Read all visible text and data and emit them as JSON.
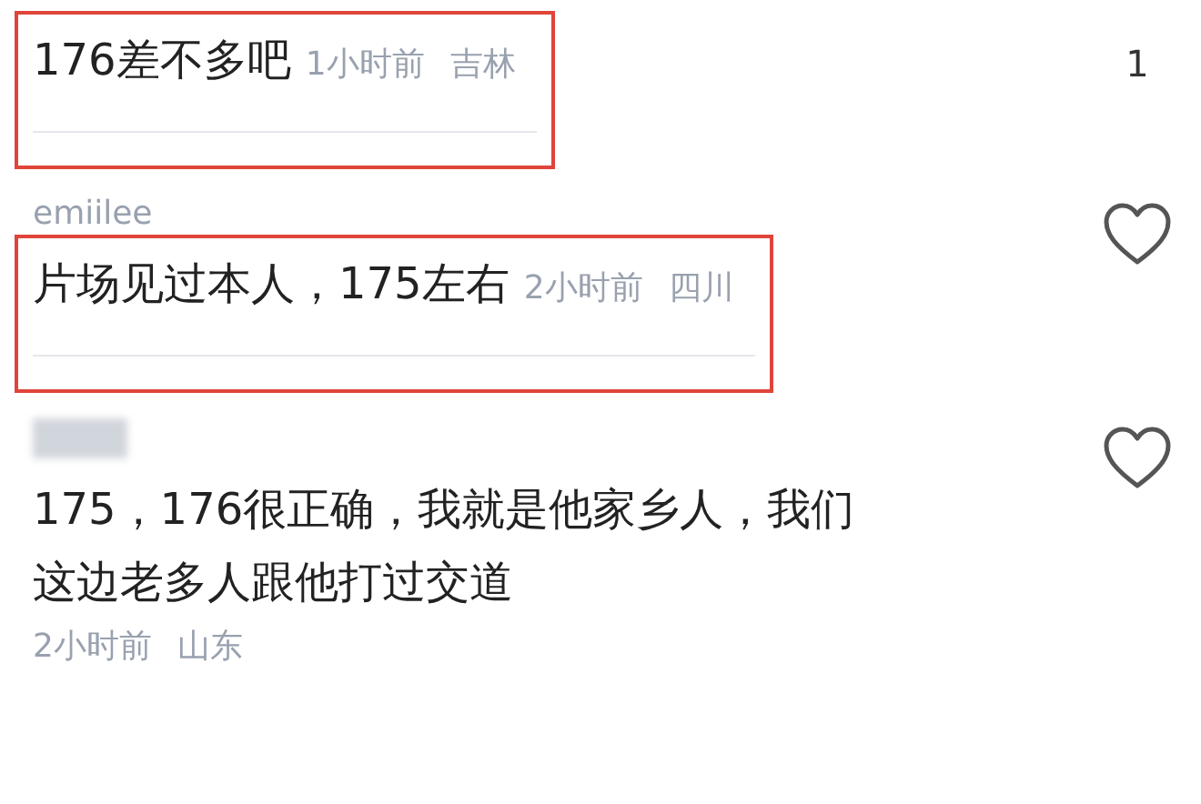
{
  "comments": [
    {
      "kind": "inline",
      "text": "176差不多吧",
      "time": "1小时前",
      "location": "吉林",
      "likes": "1",
      "highlighted": true
    },
    {
      "kind": "inline",
      "username": "emiilee",
      "text": "片场见过本人，175左右",
      "time": "2小时前",
      "location": "四川",
      "highlighted": true
    },
    {
      "kind": "stacked",
      "username_hidden": true,
      "text": "175，176很正确，我就是他家乡人，我们这边老多人跟他打过交道",
      "time": "2小时前",
      "location": "山东",
      "highlighted": false
    }
  ]
}
